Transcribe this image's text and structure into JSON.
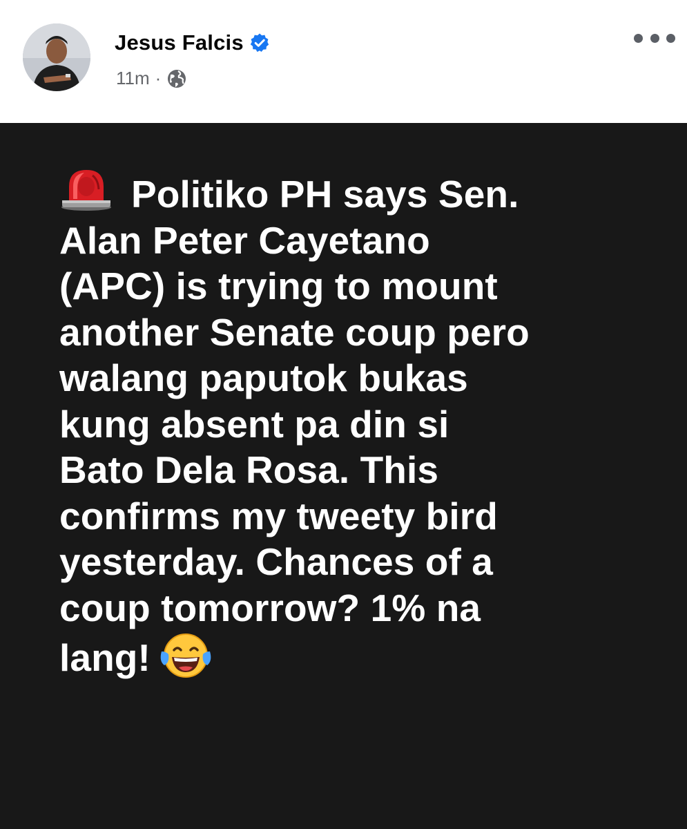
{
  "post": {
    "author": {
      "name": "Jesus Falcis",
      "verified": true,
      "avatar_icon": "profile-photo"
    },
    "meta": {
      "time": "11m",
      "separator": "·",
      "audience_icon": "globe-icon"
    },
    "more_icon": "more-options-icon",
    "body": {
      "background_color": "#181818",
      "text_color": "#ffffff",
      "lead_emoji": "police-siren-emoji",
      "text": "Politiko PH says Sen.\nAlan Peter Cayetano\n(APC) is trying to mount\nanother Senate coup pero\nwalang paputok bukas\nkung absent pa din si\nBato Dela Rosa. This\nconfirms my tweety bird\nyesterday. Chances of a\ncoup tomorrow? 1% na\nlang!",
      "trail_emoji": "tears-of-joy-emoji"
    }
  },
  "colors": {
    "verified_badge": "#1877f2",
    "meta_text": "#65676b",
    "name_text": "#050505"
  }
}
